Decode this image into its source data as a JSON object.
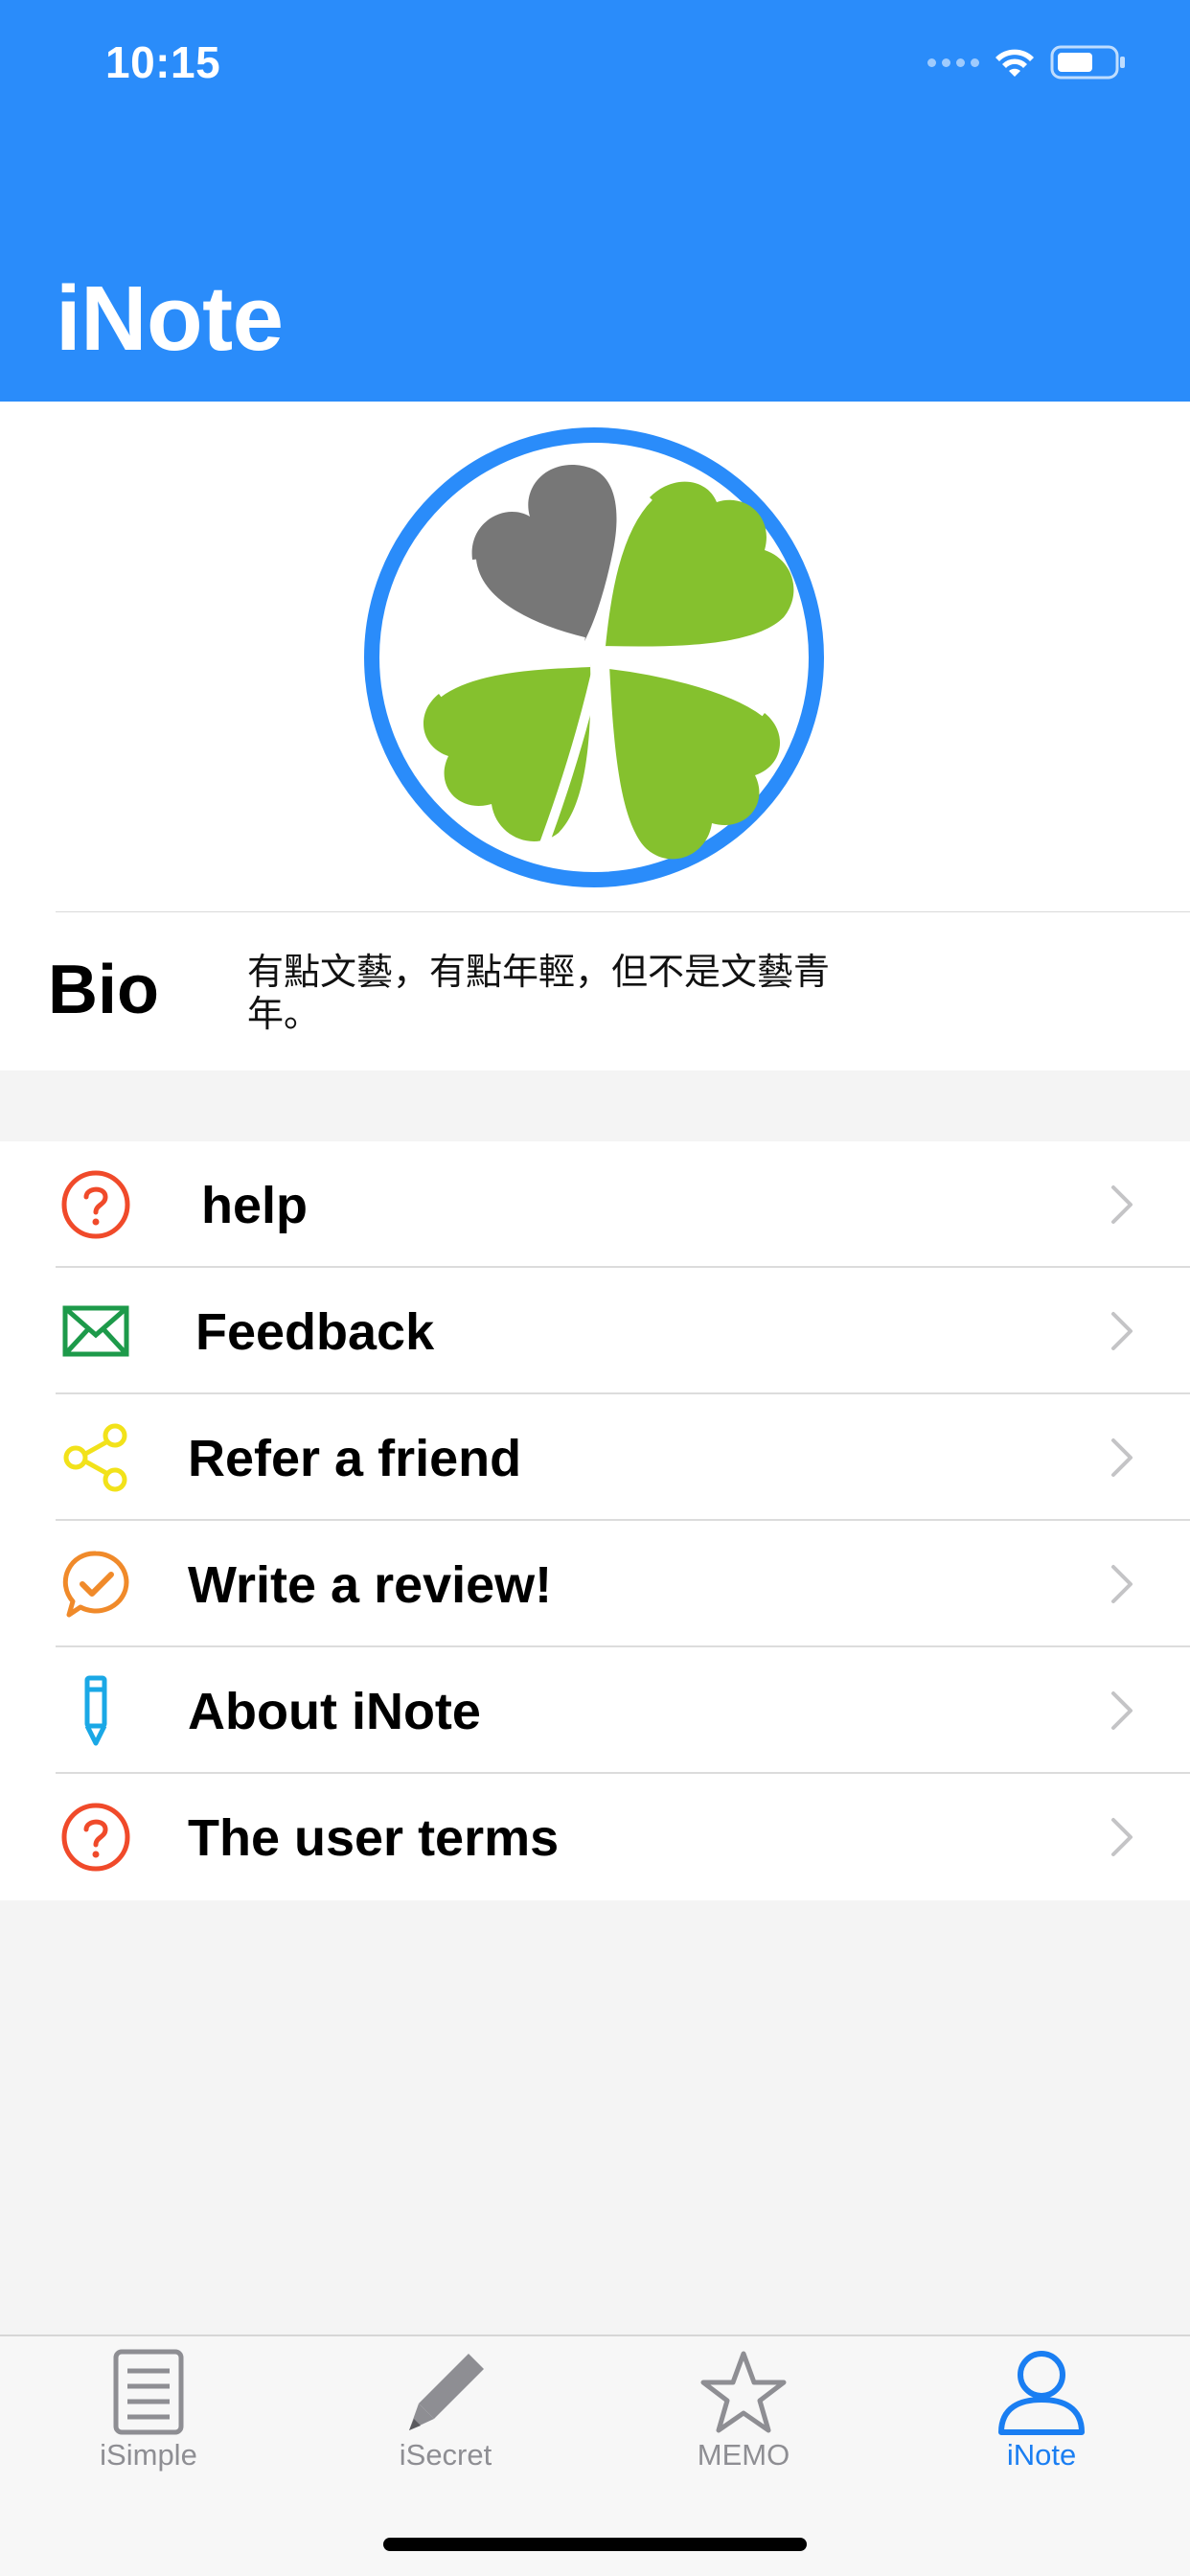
{
  "status_bar": {
    "time": "10:15"
  },
  "nav": {
    "title": "iNote"
  },
  "profile": {
    "bio_label": "Bio",
    "bio_text": "有點文藝，有點年輕，但不是文藝青年。"
  },
  "menu": {
    "items": [
      {
        "label": "help",
        "icon": "question-icon",
        "color": "#f04a2a"
      },
      {
        "label": "Feedback",
        "icon": "envelope-icon",
        "color": "#1d9a4a"
      },
      {
        "label": "Refer a friend",
        "icon": "share-icon",
        "color": "#f2e21a"
      },
      {
        "label": "Write a review!",
        "icon": "review-check-icon",
        "color": "#f08a2a"
      },
      {
        "label": "About iNote",
        "icon": "pen-icon",
        "color": "#1aa8e6"
      },
      {
        "label": "The user terms",
        "icon": "question-icon",
        "color": "#f04a2a"
      }
    ]
  },
  "tabbar": {
    "tabs": [
      {
        "label": "iSimple",
        "icon": "document-icon",
        "active": false
      },
      {
        "label": "iSecret",
        "icon": "pencil-icon",
        "active": false
      },
      {
        "label": "MEMO",
        "icon": "star-icon",
        "active": false
      },
      {
        "label": "iNote",
        "icon": "person-icon",
        "active": true
      }
    ]
  },
  "colors": {
    "header": "#2a8cfa",
    "active_tab": "#1a7ef2",
    "inactive_tab": "#8e8e93",
    "clover_green": "#85c12e",
    "clover_gray": "#777777"
  }
}
